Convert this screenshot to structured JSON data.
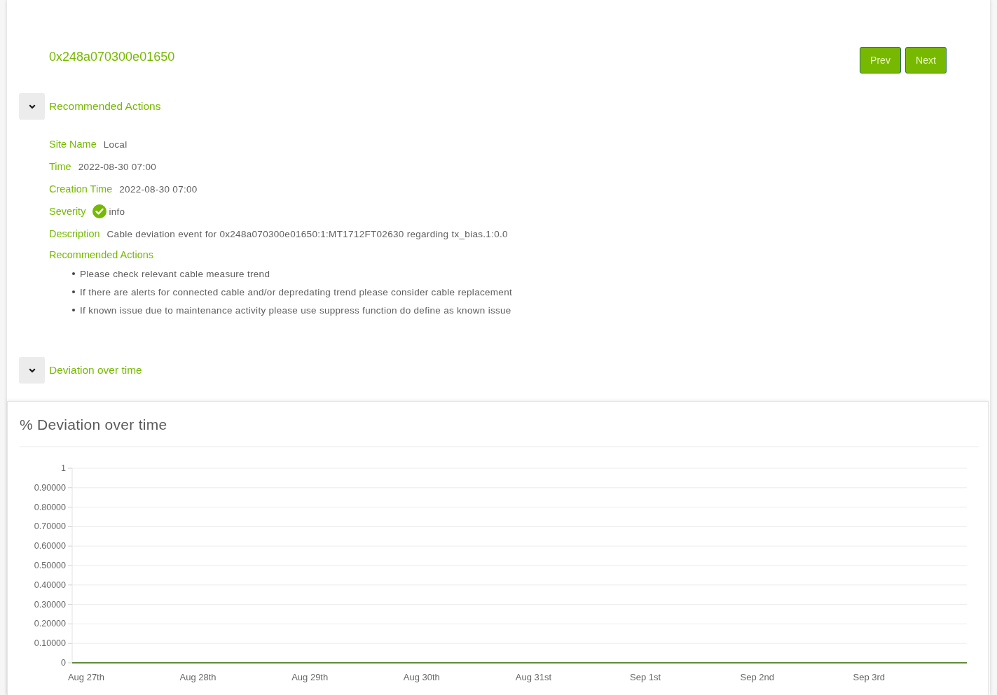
{
  "header": {
    "title": "0x248a070300e01650",
    "buttons": [
      "Prev",
      "Next"
    ]
  },
  "sections": [
    {
      "kind": "details",
      "title": "Recommended Actions",
      "expanded": true,
      "fields": [
        {
          "kind": "text",
          "label": "Site Name",
          "value": "Local"
        },
        {
          "kind": "text",
          "label": "Time",
          "value": "2022-08-30 07:00"
        },
        {
          "kind": "text",
          "label": "Creation Time",
          "value": "2022-08-30 07:00"
        },
        {
          "kind": "severity",
          "label": "Severity",
          "value": "info"
        },
        {
          "kind": "text",
          "label": "Description",
          "value": "Cable deviation event for 0x248a070300e01650:1:MT1712FT02630 regarding tx_bias.1:0.0"
        }
      ],
      "recommended_actions": {
        "label": "Recommended Actions",
        "items": [
          "Please check relevant cable measure trend",
          "If there are alerts for connected cable and/or depredating trend please consider cable replacement",
          "If known issue due to maintenance activity please use suppress function do define as known issue"
        ]
      }
    },
    {
      "kind": "chart",
      "title": "Deviation over time",
      "expanded": true,
      "card": {
        "title": "% Deviation over time",
        "chart_data": {
          "type": "line",
          "categories": [
            null,
            "Aug 27th",
            null,
            null,
            null,
            null,
            null,
            null,
            null,
            "Aug 28th",
            null,
            null,
            null,
            null,
            null,
            null,
            null,
            "Aug 29th",
            null,
            null,
            null,
            null,
            null,
            null,
            null,
            "Aug 30th",
            null,
            null,
            null,
            null,
            null,
            null,
            null,
            "Aug 31st",
            null,
            null,
            null,
            null,
            null,
            null,
            null,
            "Sep 1st",
            null,
            null,
            null,
            null,
            null,
            null,
            null,
            "Sep 2nd",
            null,
            null,
            null,
            null,
            null,
            null,
            null,
            "Sep 3rd",
            null,
            null,
            null,
            null,
            null,
            null,
            null
          ],
          "series": [
            {
              "color": "#5e8c3a",
              "values": [
                0,
                0,
                0,
                0,
                0,
                0,
                0,
                0,
                0,
                0,
                0,
                0,
                0,
                0,
                0,
                0,
                0,
                0,
                0,
                0,
                0,
                0,
                0,
                0,
                0,
                0,
                0,
                0,
                0,
                0,
                0,
                0,
                0,
                0,
                0,
                0,
                0,
                0,
                0,
                0,
                0,
                0,
                0,
                0,
                0,
                0,
                0,
                0,
                0,
                0,
                0,
                0,
                0,
                0,
                0,
                0,
                0,
                0,
                0,
                0,
                0,
                0,
                0,
                0,
                0
              ]
            }
          ],
          "ylim": [
            0,
            1
          ],
          "yticks": [
            0,
            {
              "value": 0.1,
              "label": "0.10000"
            },
            {
              "value": 0.2,
              "label": "0.20000"
            },
            {
              "value": 0.3,
              "label": "0.30000"
            },
            {
              "value": 0.4,
              "label": "0.40000"
            },
            {
              "value": 0.5,
              "label": "0.50000"
            },
            {
              "value": 0.6,
              "label": "0.60000"
            },
            {
              "value": 0.7,
              "label": "0.70000"
            },
            {
              "value": 0.8,
              "label": "0.80000"
            },
            {
              "value": 0.9,
              "label": "0.90000"
            },
            1
          ],
          "grid": true
        }
      }
    }
  ]
}
